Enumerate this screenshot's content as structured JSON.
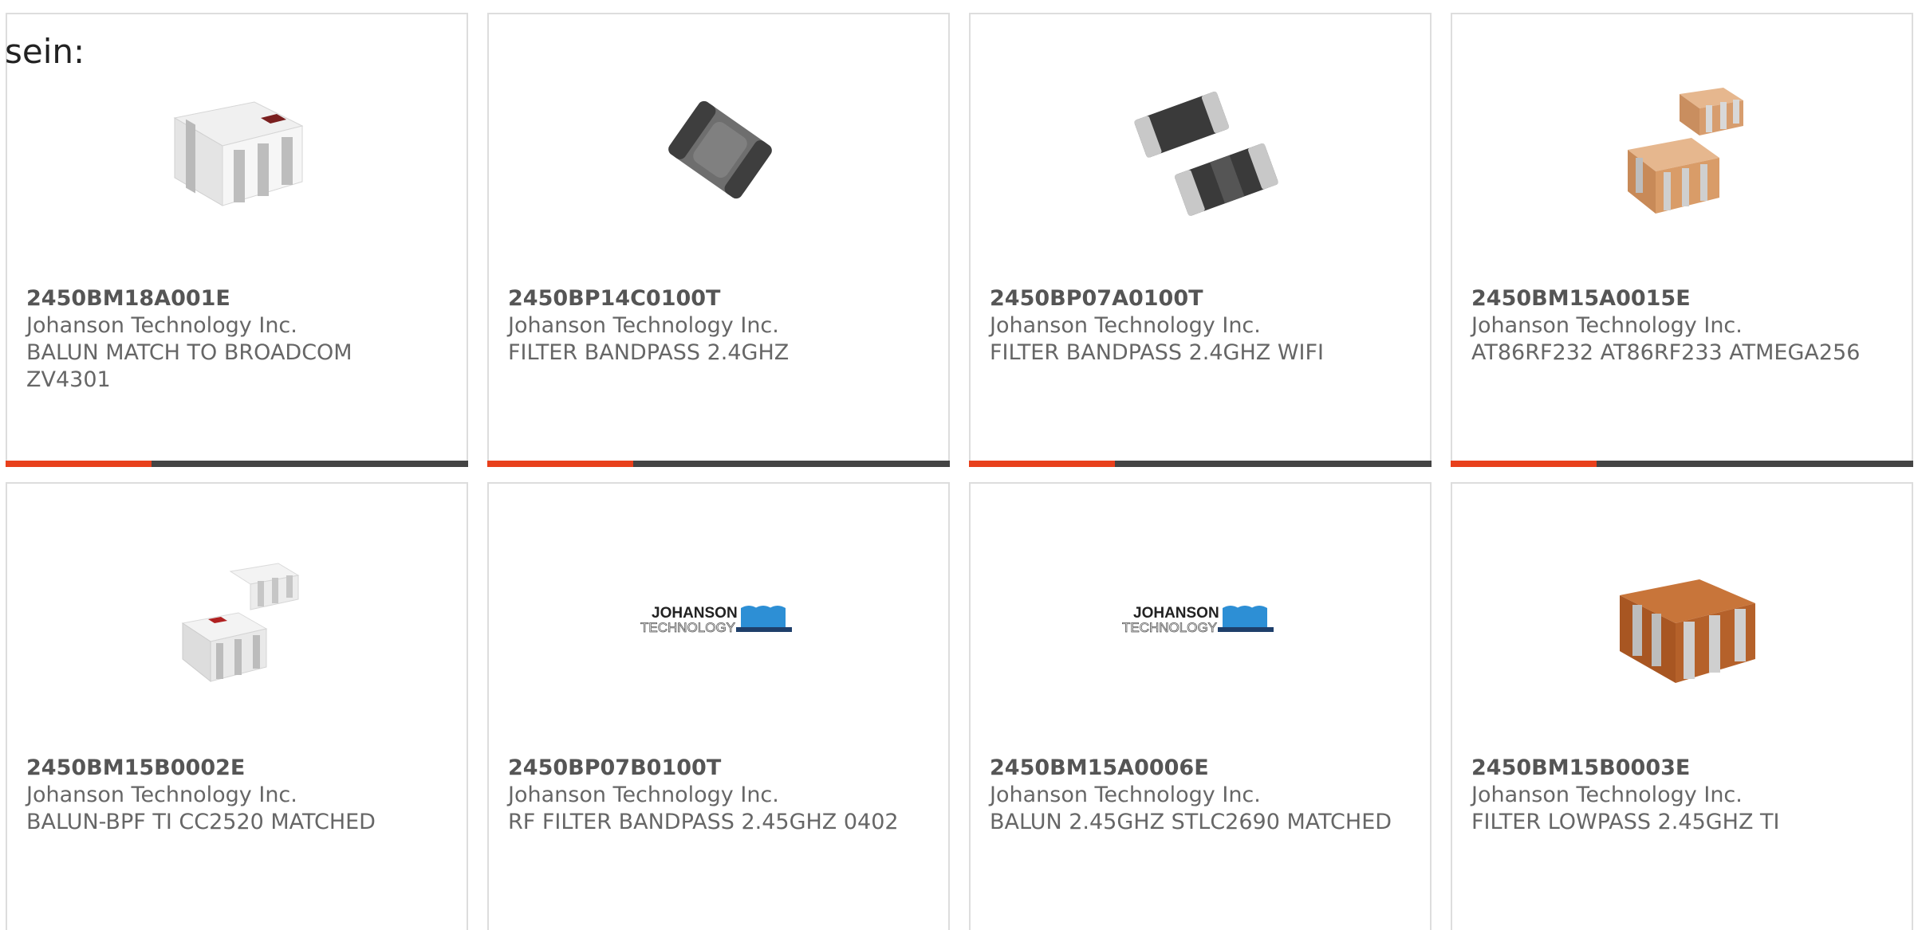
{
  "intro_text": "sein:",
  "colors": {
    "accent": "#e8401c",
    "bar": "#444444",
    "text": "#666666",
    "border": "#dddddd"
  },
  "products": [
    {
      "part": "2450BM18A001E",
      "manufacturer": "Johanson Technology Inc.",
      "description": "BALUN MATCH TO BROADCOM ZV4301",
      "image": "white-chip-component"
    },
    {
      "part": "2450BP14C0100T",
      "manufacturer": "Johanson Technology Inc.",
      "description": "FILTER BANDPASS 2.4GHZ",
      "image": "gray-chip-component"
    },
    {
      "part": "2450BP07A0100T",
      "manufacturer": "Johanson Technology Inc.",
      "description": "FILTER BANDPASS 2.4GHZ WIFI",
      "image": "dark-chip-pair"
    },
    {
      "part": "2450BM15A0015E",
      "manufacturer": "Johanson Technology Inc.",
      "description": "AT86RF232 AT86RF233 ATMEGA256",
      "image": "tan-chip-pair"
    },
    {
      "part": "2450BM15B0002E",
      "manufacturer": "Johanson Technology Inc.",
      "description": "BALUN-BPF TI CC2520 MATCHED",
      "image": "white-chip-pair"
    },
    {
      "part": "2450BP07B0100T",
      "manufacturer": "Johanson Technology Inc.",
      "description": "RF FILTER BANDPASS 2.45GHZ 0402",
      "image": "johanson-logo",
      "logo_text": [
        "JOHANSON",
        "TECHNOLOGY"
      ]
    },
    {
      "part": "2450BM15A0006E",
      "manufacturer": "Johanson Technology Inc.",
      "description": "BALUN 2.45GHZ STLC2690 MATCHED",
      "image": "johanson-logo",
      "logo_text": [
        "JOHANSON",
        "TECHNOLOGY"
      ]
    },
    {
      "part": "2450BM15B0003E",
      "manufacturer": "Johanson Technology Inc.",
      "description": "FILTER LOWPASS 2.45GHZ TI",
      "image": "brown-chip-component"
    }
  ]
}
